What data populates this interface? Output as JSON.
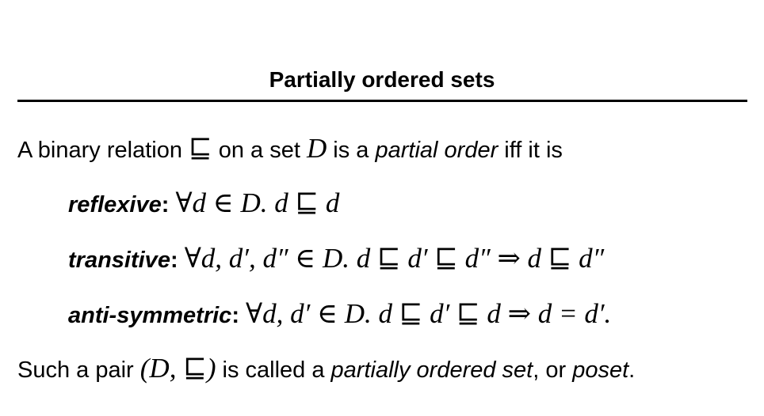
{
  "title": "Partially ordered sets",
  "intro": {
    "t1": "A binary relation ",
    "m1": "⊑",
    "t2": " on a set ",
    "m2": "D",
    "t3": " is a ",
    "emph": "partial order",
    "t4": " iff it is"
  },
  "properties": [
    {
      "name": "reflexive",
      "colon": ":",
      "formula": "∀d ∈ D. d ⊑ d"
    },
    {
      "name": "transitive",
      "colon": ":",
      "formula": "∀d, d′, d″ ∈ D. d ⊑ d′ ⊑ d″ ⇒ d ⊑ d″"
    },
    {
      "name": "anti-symmetric",
      "colon": ":",
      "formula": "∀d, d′ ∈ D. d ⊑ d′ ⊑ d ⇒ d = d′."
    }
  ],
  "conclusion": {
    "t1": "Such a pair ",
    "math": "(D, ⊑)",
    "t2": " is called a ",
    "emph1": "partially ordered set",
    "t3": ", or ",
    "emph2": "poset",
    "t4": "."
  }
}
